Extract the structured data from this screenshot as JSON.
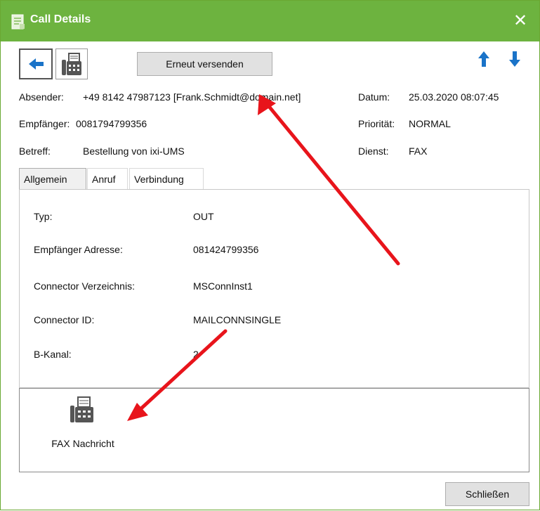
{
  "window": {
    "title": "Call Details",
    "close_icon": "close-icon"
  },
  "toolbar": {
    "back_icon": "arrow-left-icon",
    "fax_icon": "fax-icon",
    "resend_label": "Erneut versenden",
    "up_icon": "arrow-up-icon",
    "down_icon": "arrow-down-icon"
  },
  "header": {
    "sender_label": "Absender:",
    "sender_value": "+49 8142 47987123 [Frank.Schmidt@domain.net]",
    "recipient_label": "Empfänger:",
    "recipient_value": "0081794799356",
    "subject_label": "Betreff:",
    "subject_value": "Bestellung von ixi-UMS",
    "date_label": "Datum:",
    "date_value": "25.03.2020 08:07:45",
    "priority_label": "Priorität:",
    "priority_value": "NORMAL",
    "service_label": "Dienst:",
    "service_value": "FAX"
  },
  "tabs": [
    {
      "label": "Allgemein",
      "active": true
    },
    {
      "label": "Anruf",
      "active": false
    },
    {
      "label": "Verbindung",
      "active": false
    }
  ],
  "details": [
    {
      "label": "Typ:",
      "value": "OUT"
    },
    {
      "label": "Empfänger Adresse:",
      "value": "081424799356"
    },
    {
      "label": "Connector Verzeichnis:",
      "value": "MSConnInst1"
    },
    {
      "label": "Connector ID:",
      "value": "MAILCONNSINGLE"
    },
    {
      "label": "B-Kanal:",
      "value": "2"
    }
  ],
  "attachment": {
    "icon": "fax-icon",
    "label": "FAX Nachricht"
  },
  "footer": {
    "close_label": "Schließen"
  },
  "colors": {
    "titlebar": "#6db33f",
    "accent_blue": "#1a73c8",
    "annotation_red": "#e8141b"
  }
}
